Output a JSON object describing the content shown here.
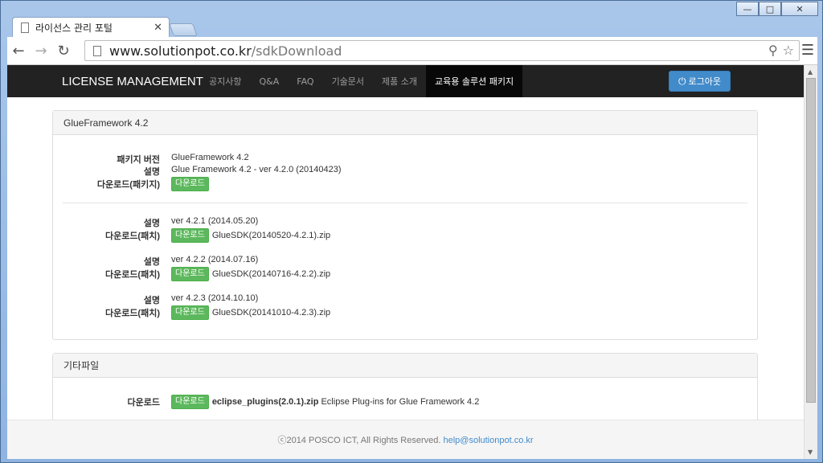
{
  "browser": {
    "tab_title": "라이선스 관리 포털",
    "url_host": "www.solutionpot.co.kr",
    "url_path": "/sdkDownload",
    "icons": [
      "back-icon",
      "forward-icon",
      "reload-icon",
      "page-icon",
      "search-icon",
      "star-icon",
      "menu-icon"
    ]
  },
  "navbar": {
    "brand": "LICENSE MANAGEMENT",
    "links": [
      "공지사항",
      "Q&A",
      "FAQ",
      "기술문서",
      "제품 소개",
      "교육용 솔루션 패키지"
    ],
    "active_index": 5,
    "logout_label": "로그아웃"
  },
  "panel1": {
    "title": "GlueFramework 4.2",
    "package": {
      "version_label": "패키지 버전",
      "version_value": "GlueFramework 4.2",
      "desc_label": "설명",
      "desc_value": "Glue Framework 4.2 - ver 4.2.0 (20140423)",
      "download_label": "다운로드(패키지)",
      "download_button": "다운로드"
    },
    "patches": [
      {
        "desc_label": "설명",
        "desc_value": "ver 4.2.1 (2014.05.20)",
        "download_label": "다운로드(패치)",
        "download_button": "다운로드",
        "file": "GlueSDK(20140520-4.2.1).zip"
      },
      {
        "desc_label": "설명",
        "desc_value": "ver 4.2.2 (2014.07.16)",
        "download_label": "다운로드(패치)",
        "download_button": "다운로드",
        "file": "GlueSDK(20140716-4.2.2).zip"
      },
      {
        "desc_label": "설명",
        "desc_value": "ver 4.2.3 (2014.10.10)",
        "download_label": "다운로드(패치)",
        "download_button": "다운로드",
        "file": "GlueSDK(20141010-4.2.3).zip"
      }
    ]
  },
  "panel2": {
    "title": "기타파일",
    "download_label": "다운로드",
    "download_button": "다운로드",
    "file": "eclipse_plugins(2.0.1).zip",
    "file_desc": "Eclipse Plug-ins for Glue Framework 4.2"
  },
  "footer": {
    "copyright": "ⓒ2014 POSCO ICT, All Rights Reserved.",
    "email": "help@solutionpot.co.kr"
  },
  "colors": {
    "navbar": "#222222",
    "primary": "#428bca",
    "success": "#5cb85c"
  }
}
